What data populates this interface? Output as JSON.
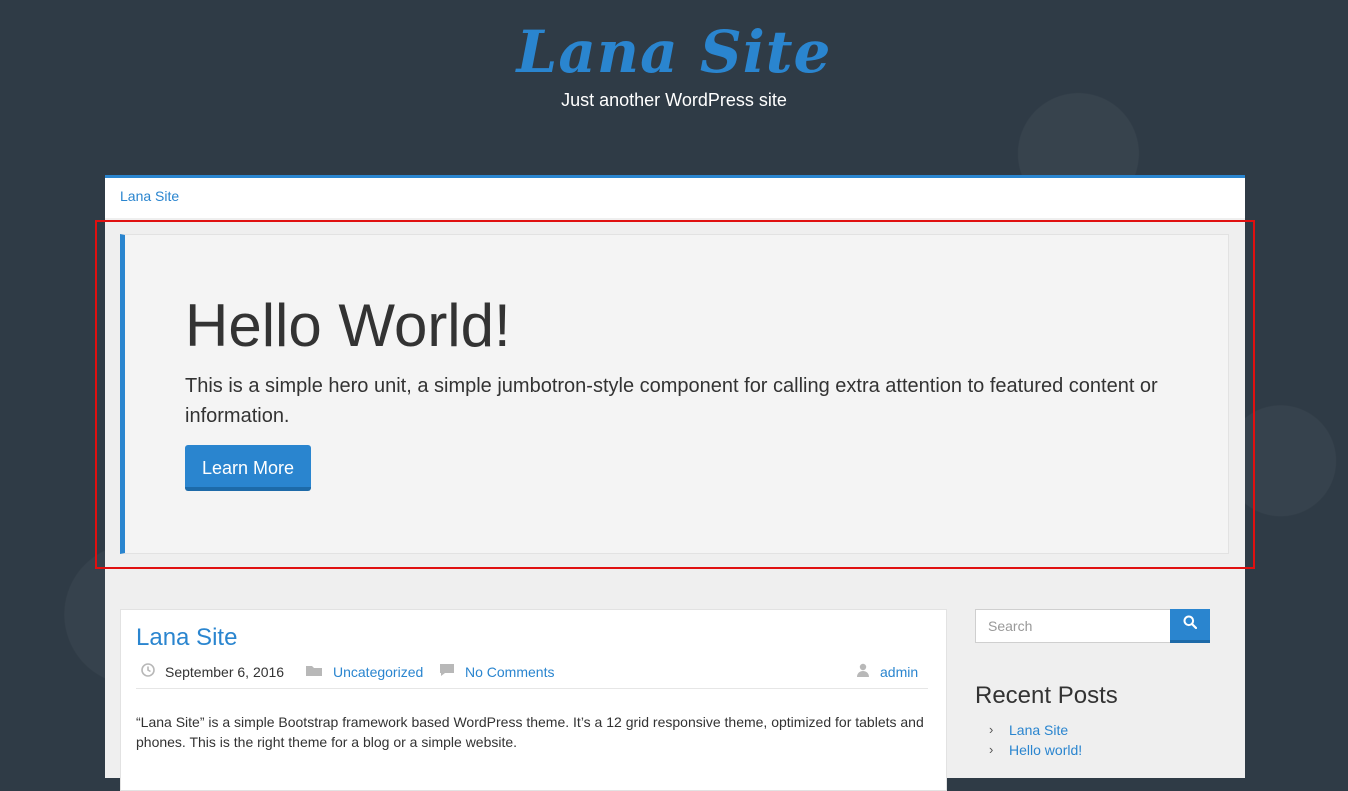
{
  "header": {
    "site_title": "Lana Site",
    "tagline": "Just another WordPress site"
  },
  "navbar": {
    "brand_link": "Lana Site"
  },
  "hero": {
    "heading": "Hello World!",
    "text": "This is a simple hero unit, a simple jumbotron-style component for calling extra attention to featured content or information.",
    "button_label": "Learn More"
  },
  "post": {
    "title": "Lana Site",
    "date": "September 6, 2016",
    "category": "Uncategorized",
    "comments": "No Comments",
    "author": "admin",
    "excerpt": "“Lana Site” is a simple Bootstrap framework based WordPress theme. It’s a 12 grid responsive theme, optimized for tablets and phones. This is the right theme for a blog or a simple website."
  },
  "sidebar": {
    "search_placeholder": "Search",
    "recent_title": "Recent Posts",
    "recent_posts": [
      "Lana Site",
      "Hello world!"
    ]
  },
  "colors": {
    "accent": "#2a85cf",
    "background": "#2f3b46",
    "highlight_box": "#e01010"
  },
  "icons": {
    "date": "clock-icon",
    "category": "folder-icon",
    "comments": "comment-icon",
    "author": "user-icon",
    "search": "search-icon",
    "list_bullet": "chevron-right-icon"
  }
}
